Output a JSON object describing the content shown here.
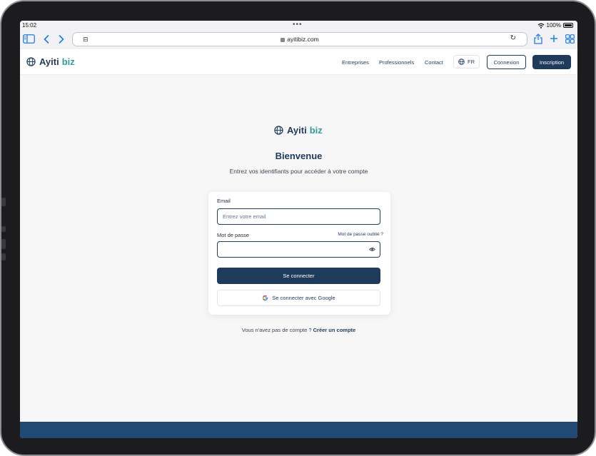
{
  "status_bar": {
    "time": "15:02",
    "battery": "100%"
  },
  "browser": {
    "url": "ayitibiz.com"
  },
  "header": {
    "logo_main": "Ayiti",
    "logo_accent": "biz",
    "nav": [
      "Entreprises",
      "Professionnels",
      "Contact"
    ],
    "language": "FR",
    "login_label": "Connexion",
    "signup_label": "Inscription"
  },
  "login": {
    "logo_main": "Ayiti",
    "logo_accent": "biz",
    "title": "Bienvenue",
    "subtitle": "Entrez vos identifiants pour accéder à votre compte",
    "email_label": "Email",
    "email_placeholder": "Entrez votre email",
    "password_label": "Mot de passe",
    "forgot_label": "Mot de passe oublié ?",
    "submit_label": "Se connecter",
    "google_label": "Se connecter avec Google",
    "no_account_text": "Vous n'avez pas de compte ?",
    "create_account_label": "Créer un compte"
  },
  "colors": {
    "primary": "#1f3b5c",
    "accent": "#2e9d96",
    "footer": "#214a72",
    "safari_blue": "#1a7cf0"
  }
}
